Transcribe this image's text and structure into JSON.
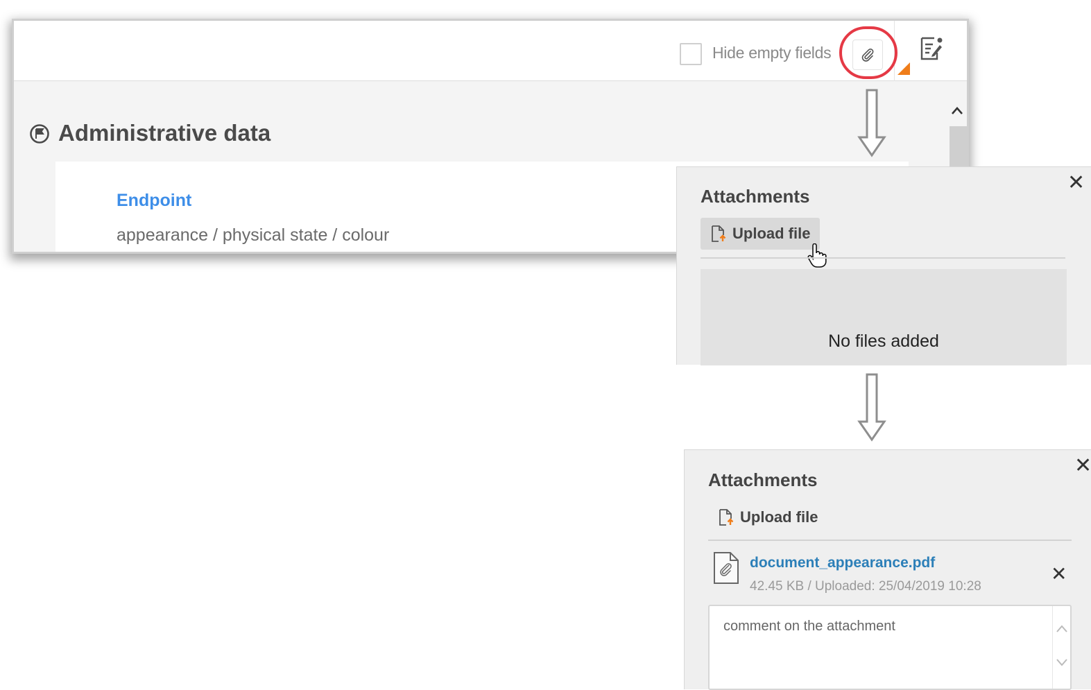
{
  "toolbar": {
    "hide_empty_label": "Hide empty fields",
    "attach_icon": "paperclip-icon",
    "notes_icon": "edit-notes-icon"
  },
  "section": {
    "title": "Administrative data",
    "icon": "flag-circle-icon",
    "field_label": "Endpoint",
    "field_value": "appearance / physical state / colour"
  },
  "panel_empty": {
    "title": "Attachments",
    "upload_label": "Upload file",
    "empty_message": "No files added",
    "close_icon": "close-icon"
  },
  "panel_filled": {
    "title": "Attachments",
    "upload_label": "Upload file",
    "file": {
      "name": "document_appearance.pdf",
      "meta": "42.45 KB / Uploaded: 25/04/2019 10:28"
    },
    "comment": "comment on the attachment",
    "close_icon": "close-icon"
  },
  "colors": {
    "link_blue": "#3e8ee8",
    "file_link": "#2c7fb8",
    "highlight": "#e53945",
    "accent_orange": "#ef7d1a"
  }
}
